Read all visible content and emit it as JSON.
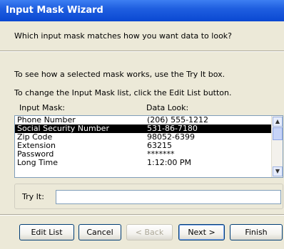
{
  "window": {
    "title": "Input Mask Wizard"
  },
  "prompt": "Which input mask matches how you want data to look?",
  "instructions": [
    "To see how a selected mask works, use the Try It box.",
    "To change the Input Mask list, click the Edit List button."
  ],
  "list": {
    "header_mask": "Input Mask:",
    "header_data": "Data Look:",
    "rows": [
      {
        "mask": "Phone Number",
        "data": "(206) 555-1212"
      },
      {
        "mask": "Social Security Number",
        "data": "531-86-7180"
      },
      {
        "mask": "Zip Code",
        "data": "98052-6399"
      },
      {
        "mask": "Extension",
        "data": "63215"
      },
      {
        "mask": "Password",
        "data": "*******"
      },
      {
        "mask": "Long Time",
        "data": "1:12:00 PM"
      }
    ],
    "selected": "Social Security Number"
  },
  "tryit": {
    "label": "Try It:",
    "value": ""
  },
  "buttons": {
    "edit_list": "Edit List",
    "cancel": "Cancel",
    "back": "< Back",
    "next": "Next >",
    "finish": "Finish"
  }
}
